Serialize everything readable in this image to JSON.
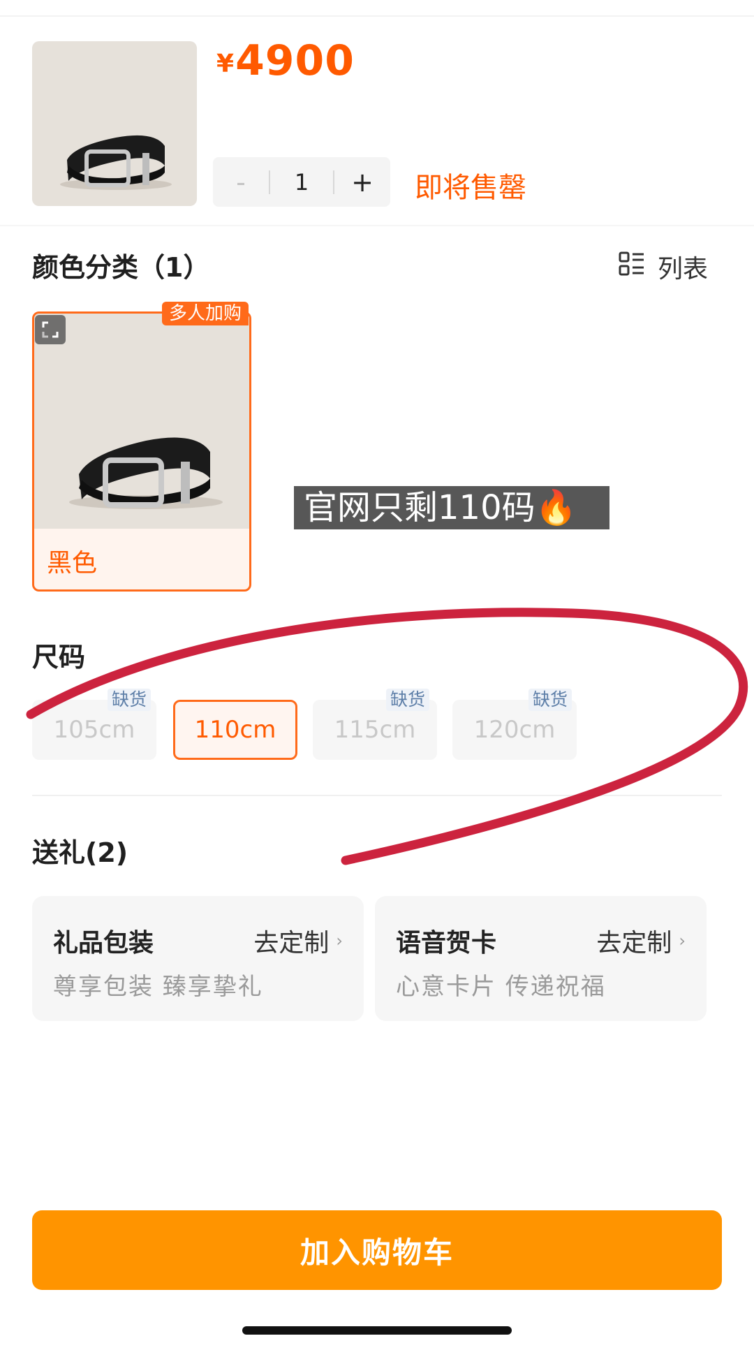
{
  "product": {
    "currency": "¥",
    "price": "4900",
    "quantity": "1",
    "minus_label": "-",
    "plus_label": "+",
    "stock_status": "即将售罄"
  },
  "color_section": {
    "title": "颜色分类（1）",
    "view_toggle": "列表",
    "options": [
      {
        "name": "黑色",
        "badge": "多人加购",
        "selected": true
      }
    ]
  },
  "overlay_text": "官网只剩110码🔥",
  "size_section": {
    "title": "尺码",
    "options": [
      {
        "label": "105cm",
        "badge": "缺货",
        "selected": false,
        "available": false
      },
      {
        "label": "110cm",
        "badge": "",
        "selected": true,
        "available": true
      },
      {
        "label": "115cm",
        "badge": "缺货",
        "selected": false,
        "available": false
      },
      {
        "label": "120cm",
        "badge": "缺货",
        "selected": false,
        "available": false
      }
    ]
  },
  "gift_section": {
    "title": "送礼(2)",
    "items": [
      {
        "title": "礼品包装",
        "action": "去定制",
        "subtitle": "尊享包装 臻享挚礼"
      },
      {
        "title": "语音贺卡",
        "action": "去定制",
        "subtitle": "心意卡片 传递祝福"
      }
    ]
  },
  "cart_button": "加入购物车",
  "colors": {
    "accent": "#ff5a00",
    "button": "#ff9400",
    "annotation_stroke": "#c8102e"
  }
}
